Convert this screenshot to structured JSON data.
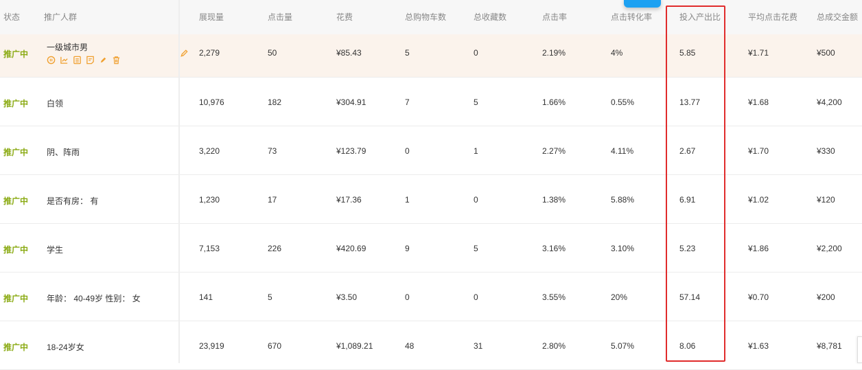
{
  "headers": [
    "状态",
    "推广人群",
    "展现量",
    "点击量",
    "花费",
    "总购物车数",
    "总收藏数",
    "点击率",
    "点击转化率",
    "投入产出比",
    "平均点击花费",
    "总成交金额"
  ],
  "rows": [
    {
      "status": "推广中",
      "crowd": "一级城市男",
      "impressions": "2,279",
      "clicks": "50",
      "cost": "¥85.43",
      "cart": "5",
      "fav": "0",
      "ctr": "2.19%",
      "cvr": "4%",
      "roi": "5.85",
      "cpc": "¥1.71",
      "gmv": "¥500"
    },
    {
      "status": "推广中",
      "crowd": "白领",
      "impressions": "10,976",
      "clicks": "182",
      "cost": "¥304.91",
      "cart": "7",
      "fav": "5",
      "ctr": "1.66%",
      "cvr": "0.55%",
      "roi": "13.77",
      "cpc": "¥1.68",
      "gmv": "¥4,200"
    },
    {
      "status": "推广中",
      "crowd": "阴、阵雨",
      "impressions": "3,220",
      "clicks": "73",
      "cost": "¥123.79",
      "cart": "0",
      "fav": "1",
      "ctr": "2.27%",
      "cvr": "4.11%",
      "roi": "2.67",
      "cpc": "¥1.70",
      "gmv": "¥330"
    },
    {
      "status": "推广中",
      "crowd": "是否有房： 有",
      "impressions": "1,230",
      "clicks": "17",
      "cost": "¥17.36",
      "cart": "1",
      "fav": "0",
      "ctr": "1.38%",
      "cvr": "5.88%",
      "roi": "6.91",
      "cpc": "¥1.02",
      "gmv": "¥120"
    },
    {
      "status": "推广中",
      "crowd": "学生",
      "impressions": "7,153",
      "clicks": "226",
      "cost": "¥420.69",
      "cart": "9",
      "fav": "5",
      "ctr": "3.16%",
      "cvr": "3.10%",
      "roi": "5.23",
      "cpc": "¥1.86",
      "gmv": "¥2,200"
    },
    {
      "status": "推广中",
      "crowd": "年龄： 40-49岁 性别： 女",
      "impressions": "141",
      "clicks": "5",
      "cost": "¥3.50",
      "cart": "0",
      "fav": "0",
      "ctr": "3.55%",
      "cvr": "20%",
      "roi": "57.14",
      "cpc": "¥0.70",
      "gmv": "¥200"
    },
    {
      "status": "推广中",
      "crowd": "18-24岁女",
      "impressions": "23,919",
      "clicks": "670",
      "cost": "¥1,089.21",
      "cart": "48",
      "fav": "31",
      "ctr": "2.80%",
      "cvr": "5.07%",
      "roi": "8.06",
      "cpc": "¥1.63",
      "gmv": "¥8,781"
    }
  ],
  "colors": {
    "status": "#8aaa12",
    "action_icons": "#f0a030",
    "highlight": "#e02b2b"
  }
}
